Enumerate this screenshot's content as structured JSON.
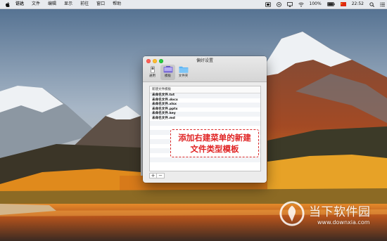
{
  "menubar": {
    "apple_icon": "apple-logo-icon",
    "items": [
      {
        "label": "访达",
        "app": true
      },
      {
        "label": "文件"
      },
      {
        "label": "编辑"
      },
      {
        "label": "显示"
      },
      {
        "label": "前往"
      },
      {
        "label": "窗口"
      },
      {
        "label": "帮助"
      }
    ],
    "status": {
      "icons": [
        "app-status-icon",
        "control-icon",
        "airplay-icon",
        "wifi-icon"
      ],
      "battery_percent": "100%",
      "battery_level": 1.0,
      "flag_icon": "flag-icon",
      "time": "22:52",
      "search_icon": "spotlight-search-icon",
      "list_icon": "notification-center-icon"
    }
  },
  "window": {
    "title": "偏好设置",
    "toolbar": [
      {
        "label": "通用",
        "icon": "switch-icon",
        "selected": false
      },
      {
        "label": "模板",
        "icon": "template-icon",
        "selected": true
      },
      {
        "label": "文件夹",
        "icon": "folder-icon",
        "selected": false
      }
    ],
    "panel": {
      "header": "新建文件模板",
      "rows": [
        "未命名文件.txt",
        "未命名文件.docx",
        "未命名文件.xlsx",
        "未命名文件.pptx",
        "未命名文件.key",
        "未命名文件.md"
      ]
    },
    "add_label": "+",
    "remove_label": "−"
  },
  "callout": {
    "line1": "添加右建菜单的新建",
    "line2": "文件类型模板",
    "color": "#e02424"
  },
  "watermark": {
    "name": "当下软件园",
    "url": "www.downxia.com"
  },
  "colors": {
    "traffic_close": "#fc5f57",
    "traffic_min": "#fdbc2e",
    "traffic_max": "#29c841",
    "folder_blue": "#5bb4f4"
  }
}
